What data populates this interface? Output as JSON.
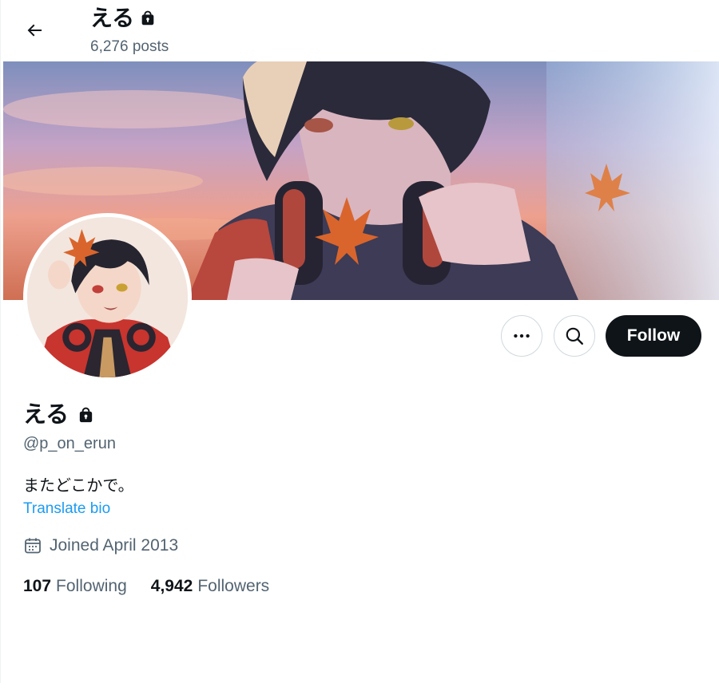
{
  "header": {
    "display_name": "える",
    "post_count": "6,276 posts"
  },
  "actions": {
    "follow_label": "Follow"
  },
  "profile": {
    "display_name": "える",
    "handle": "@p_on_erun",
    "bio": "またどこかで。",
    "translate_label": "Translate bio",
    "joined": "Joined April 2013",
    "following_count": "107",
    "following_label": "Following",
    "followers_count": "4,942",
    "followers_label": "Followers"
  },
  "icons": {
    "back": "arrow-left-icon",
    "lock": "lock-icon",
    "more": "more-icon",
    "search": "search-icon",
    "calendar": "calendar-icon"
  },
  "colors": {
    "text": "#0f1419",
    "secondary": "#536471",
    "link": "#1d9bf0",
    "follow_bg": "#0f1419",
    "border": "#cfd9de"
  }
}
